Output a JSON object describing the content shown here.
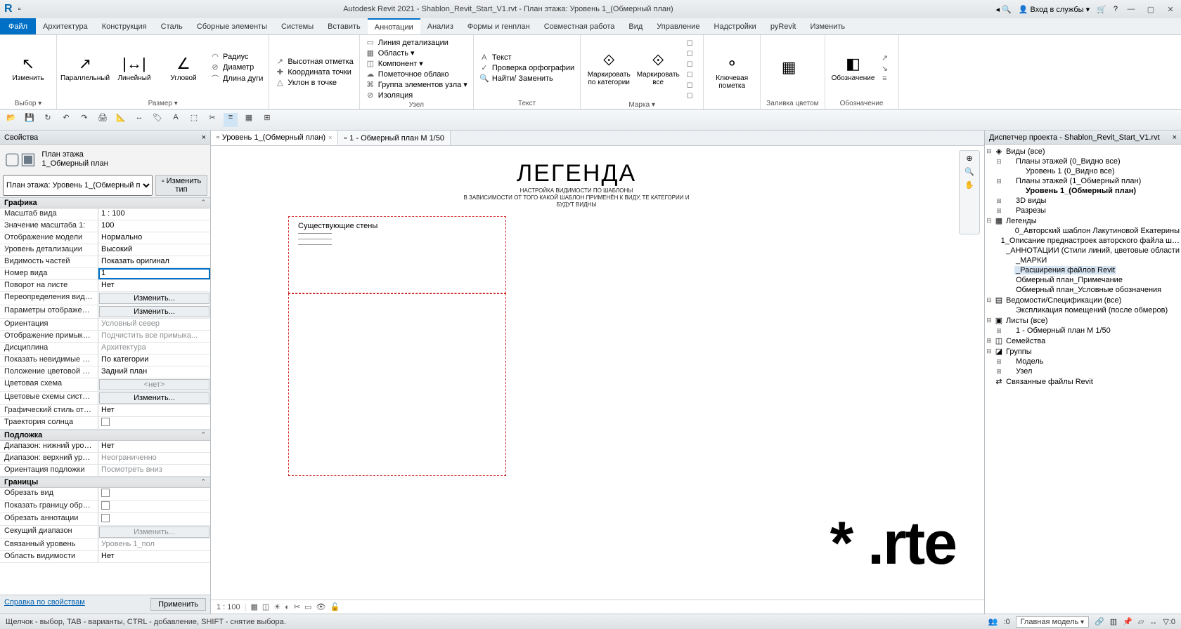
{
  "title": "Autodesk Revit 2021 - Shablon_Revit_Start_V1.rvt - План этажа: Уровень 1_(Обмерный план)",
  "login": "Вход в службы",
  "menu": {
    "file": "Файл",
    "items": [
      "Архитектура",
      "Конструкция",
      "Сталь",
      "Сборные элементы",
      "Системы",
      "Вставить",
      "Аннотации",
      "Анализ",
      "Формы и генплан",
      "Совместная работа",
      "Вид",
      "Управление",
      "Надстройки",
      "pyRevit",
      "Изменить"
    ],
    "active": 6
  },
  "ribbon": {
    "groups": [
      {
        "label": "Выбор ▾",
        "big": [
          {
            "i": "↖",
            "l": "Изменить"
          }
        ]
      },
      {
        "label": "Размер ▾",
        "big": [
          {
            "i": "↗",
            "l": "Параллельный"
          },
          {
            "i": "|↔|",
            "l": "Линейный"
          },
          {
            "i": "∠",
            "l": "Угловой"
          }
        ],
        "small": [
          {
            "i": "◠",
            "l": "Радиус"
          },
          {
            "i": "⊘",
            "l": "Диаметр"
          },
          {
            "i": "⌒",
            "l": "Длина дуги"
          }
        ]
      },
      {
        "label": "",
        "small": [
          {
            "i": "↗",
            "l": "Высотная отметка"
          },
          {
            "i": "✚",
            "l": "Координата точки"
          },
          {
            "i": "△",
            "l": "Уклон в точке"
          }
        ]
      },
      {
        "label": "Узел",
        "small": [
          {
            "i": "▭",
            "l": "Линия детализации"
          },
          {
            "i": "▦",
            "l": "Область ▾"
          },
          {
            "i": "◫",
            "l": "Компонент ▾"
          },
          {
            "i": "☁",
            "l": "Пометочное облако"
          },
          {
            "i": "⌘",
            "l": "Группа элементов узла ▾"
          },
          {
            "i": "⊘",
            "l": "Изоляция"
          }
        ]
      },
      {
        "label": "Текст",
        "small": [
          {
            "i": "A",
            "l": "Текст"
          },
          {
            "i": "✓",
            "l": "Проверка орфографии"
          },
          {
            "i": "🔍",
            "l": "Найти/ Заменить"
          }
        ]
      },
      {
        "label": "Марка ▾",
        "big": [
          {
            "i": "⟐",
            "l": "Маркировать по категории"
          },
          {
            "i": "⟐",
            "l": "Маркировать все"
          }
        ],
        "small": [
          {
            "i": "◻",
            "l": ""
          },
          {
            "i": "◻",
            "l": ""
          },
          {
            "i": "◻",
            "l": ""
          },
          {
            "i": "◻",
            "l": ""
          },
          {
            "i": "◻",
            "l": ""
          },
          {
            "i": "◻",
            "l": ""
          }
        ]
      },
      {
        "label": "",
        "big": [
          {
            "i": "⚬",
            "l": "Ключевая пометка"
          }
        ]
      },
      {
        "label": "Заливка цветом",
        "big": [
          {
            "i": "▦",
            "l": ""
          }
        ]
      },
      {
        "label": "Обозначение",
        "big": [
          {
            "i": "◧",
            "l": "Обозначение"
          }
        ],
        "small": [
          {
            "i": "↗",
            "l": ""
          },
          {
            "i": "↘",
            "l": ""
          },
          {
            "i": "≡",
            "l": ""
          }
        ]
      }
    ]
  },
  "tabs": [
    {
      "label": "Уровень 1_(Обмерный план)",
      "active": true
    },
    {
      "label": "1 - Обмерный план М 1/50",
      "active": false
    }
  ],
  "properties_panel": {
    "title": "Свойства",
    "family": {
      "line1": "План этажа",
      "line2": "1_Обмерный план"
    },
    "combo": "План этажа: Уровень 1_(Обмерный п",
    "edittype": "Изменить тип",
    "groups": [
      {
        "hdr": "Графика",
        "rows": [
          [
            "Масштаб вида",
            "1 : 100",
            ""
          ],
          [
            "Значение масштаба    1:",
            "100",
            ""
          ],
          [
            "Отображение модели",
            "Нормально",
            ""
          ],
          [
            "Уровень детализации",
            "Высокий",
            ""
          ],
          [
            "Видимость частей",
            "Показать оригинал",
            ""
          ],
          [
            "Номер вида",
            "1",
            "active"
          ],
          [
            "Поворот на листе",
            "Нет",
            ""
          ],
          [
            "Переопределения види...",
            "Изменить...",
            "btn"
          ],
          [
            "Параметры отображени...",
            "Изменить...",
            "btn"
          ],
          [
            "Ориентация",
            "Условный север",
            "gray"
          ],
          [
            "Отображение примыка...",
            "Подчистить все примыка...",
            "gray"
          ],
          [
            "Дисциплина",
            "Архитектура",
            "gray"
          ],
          [
            "Показать невидимые ли...",
            "По категории",
            ""
          ],
          [
            "Положение цветовой сх...",
            "Задний план",
            ""
          ],
          [
            "Цветовая схема",
            "<нет>",
            "btn gray"
          ],
          [
            "Цветовые схемы системы",
            "Изменить...",
            "btn"
          ],
          [
            "Графический стиль ото...",
            "Нет",
            ""
          ],
          [
            "Траектория солнца",
            "",
            "chk"
          ]
        ]
      },
      {
        "hdr": "Подложка",
        "rows": [
          [
            "Диапазон: нижний уров...",
            "Нет",
            ""
          ],
          [
            "Диапазон: верхний уров...",
            "Неограниченно",
            "gray"
          ],
          [
            "Ориентация подложки",
            "Посмотреть вниз",
            "gray"
          ]
        ]
      },
      {
        "hdr": "Границы",
        "rows": [
          [
            "Обрезать вид",
            "",
            "chk"
          ],
          [
            "Показать границу обрезки",
            "",
            "chk"
          ],
          [
            "Обрезать аннотации",
            "",
            "chk"
          ],
          [
            "Секущий диапазон",
            "Изменить...",
            "btn gray"
          ],
          [
            "Связанный уровень",
            "Уровень 1_пол",
            "gray"
          ],
          [
            "Область видимости",
            "Нет",
            ""
          ]
        ]
      }
    ],
    "help": "Справка по свойствам",
    "apply": "Применить"
  },
  "legend": {
    "title": "ЛЕГЕНДА",
    "sub1": "НАСТРОЙКА ВИДИМОСТИ ПО ШАБЛОНЫ",
    "sub2": "В ЗАВИСИМОСТИ ОТ ТОГО КАКОЙ ШАБЛОН ПРИМЕНЁН К ВИДУ, ТЕ КАТЕГОРИИ И",
    "sub3": "БУДУТ ВИДНЫ",
    "walls": "Существующие стены"
  },
  "watermark": "* .rte",
  "viewbar": {
    "scale": "1 : 100"
  },
  "browser": {
    "title": "Диспетчер проекта - Shablon_Revit_Start_V1.rvt",
    "nodes": [
      {
        "d": 0,
        "e": "⊟",
        "i": "◈",
        "l": "Виды (все)"
      },
      {
        "d": 1,
        "e": "⊟",
        "i": "",
        "l": "Планы этажей (0_Видно все)"
      },
      {
        "d": 2,
        "e": "",
        "i": "",
        "l": "Уровень 1 (0_Видно все)"
      },
      {
        "d": 1,
        "e": "⊟",
        "i": "",
        "l": "Планы этажей (1_Обмерный план)"
      },
      {
        "d": 2,
        "e": "",
        "i": "",
        "l": "Уровень 1_(Обмерный план)",
        "bold": true
      },
      {
        "d": 1,
        "e": "⊞",
        "i": "",
        "l": "3D виды"
      },
      {
        "d": 1,
        "e": "⊞",
        "i": "",
        "l": "Разрезы"
      },
      {
        "d": 0,
        "e": "⊟",
        "i": "▦",
        "l": "Легенды"
      },
      {
        "d": 1,
        "e": "",
        "i": "",
        "l": "0_Авторский шаблон Лакутиновой Екатерины"
      },
      {
        "d": 1,
        "e": "",
        "i": "",
        "l": "1_Описание преднастроек авторского файла ш…"
      },
      {
        "d": 1,
        "e": "",
        "i": "",
        "l": "_АННОТАЦИИ (Стили линий, цветовые области"
      },
      {
        "d": 1,
        "e": "",
        "i": "",
        "l": "_МАРКИ"
      },
      {
        "d": 1,
        "e": "",
        "i": "",
        "l": "_Расширения файлов Revit",
        "sel": true
      },
      {
        "d": 1,
        "e": "",
        "i": "",
        "l": "Обмерный план_Примечание"
      },
      {
        "d": 1,
        "e": "",
        "i": "",
        "l": "Обмерный план_Условные обозначения"
      },
      {
        "d": 0,
        "e": "⊟",
        "i": "▤",
        "l": "Ведомости/Спецификации (все)"
      },
      {
        "d": 1,
        "e": "",
        "i": "",
        "l": "Экспликация помещений (после обмеров)"
      },
      {
        "d": 0,
        "e": "⊟",
        "i": "▣",
        "l": "Листы (все)"
      },
      {
        "d": 1,
        "e": "⊞",
        "i": "",
        "l": "1 - Обмерный план М 1/50"
      },
      {
        "d": 0,
        "e": "⊞",
        "i": "◫",
        "l": "Семейства"
      },
      {
        "d": 0,
        "e": "⊟",
        "i": "◪",
        "l": "Группы"
      },
      {
        "d": 1,
        "e": "⊞",
        "i": "",
        "l": "Модель"
      },
      {
        "d": 1,
        "e": "⊞",
        "i": "",
        "l": "Узел"
      },
      {
        "d": 0,
        "e": "",
        "i": "⇄",
        "l": "Связанные файлы Revit"
      }
    ]
  },
  "status": {
    "hint": "Щелчок - выбор, TAB - варианты, CTRL - добавление, SHIFT - снятие выбора.",
    "sel": "Главная модель",
    "zero": ":0"
  }
}
